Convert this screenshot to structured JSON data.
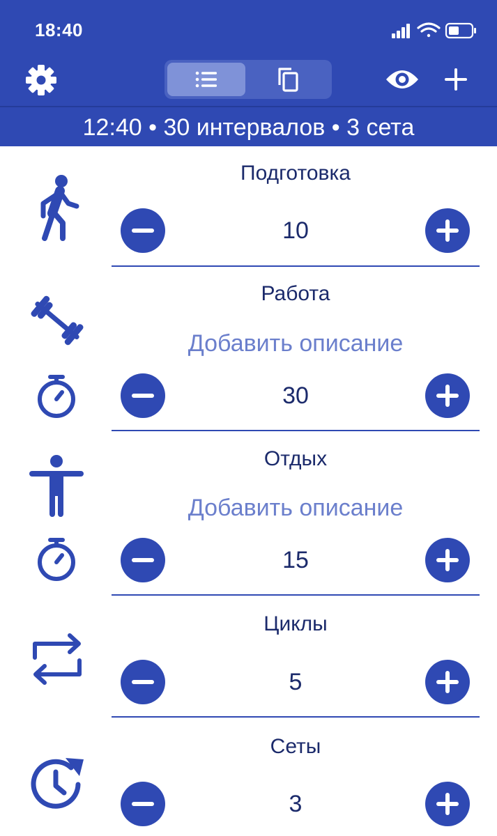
{
  "status_bar": {
    "time": "18:40"
  },
  "summary": "12:40 • 30 интервалов • 3 сета",
  "sections": {
    "prep": {
      "title": "Подготовка",
      "value": "10"
    },
    "work": {
      "title": "Работа",
      "description": "Добавить описание",
      "value": "30"
    },
    "rest": {
      "title": "Отдых",
      "description": "Добавить описание",
      "value": "15"
    },
    "cycles": {
      "title": "Циклы",
      "value": "5"
    },
    "sets": {
      "title": "Сеты",
      "value": "3"
    }
  },
  "colors": {
    "accent": "#2f49b3",
    "header_bg": "#2f49b3",
    "text": "#1b2a6b",
    "placeholder": "#6b7fcc"
  },
  "icons": [
    "settings-gear-icon",
    "list-icon",
    "copy-icon",
    "eye-icon",
    "plus-icon",
    "walking-person-icon",
    "dumbbell-icon",
    "stopwatch-icon",
    "person-standing-icon",
    "repeat-icon",
    "clock-rotate-icon",
    "minus-icon",
    "plus-icon"
  ]
}
